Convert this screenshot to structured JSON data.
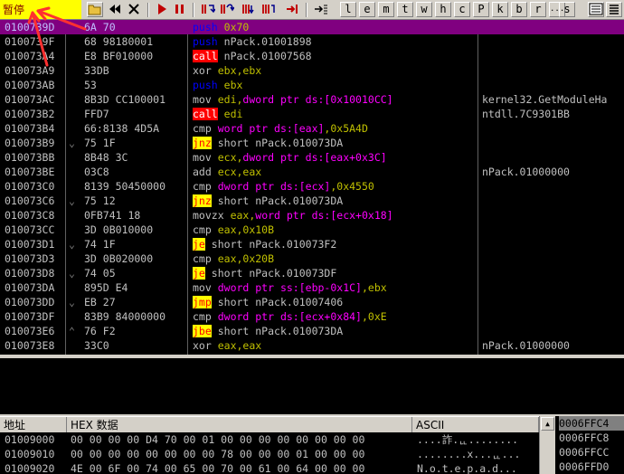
{
  "toolbar": {
    "status": "暂停",
    "letters": [
      "l",
      "e",
      "m",
      "t",
      "w",
      "h",
      "c",
      "P",
      "k",
      "b",
      "r",
      "...",
      "s"
    ]
  },
  "disasm_rows": [
    {
      "addr": "0100739D",
      "hex": "6A 70",
      "mark": "",
      "op": "push",
      "op_style": "push",
      "args": [
        {
          "t": "0x70",
          "c": "n"
        }
      ],
      "cmt": "",
      "selected": true
    },
    {
      "addr": "0100739F",
      "hex": "68 98180001",
      "mark": "",
      "op": "push",
      "op_style": "push",
      "args": [
        {
          "t": "nPack.01001898",
          "c": "w"
        }
      ],
      "cmt": ""
    },
    {
      "addr": "010073A4",
      "hex": "E8 BF010000",
      "mark": "",
      "op": "call",
      "op_style": "call",
      "args": [
        {
          "t": "nPack.01007568",
          "c": "w"
        }
      ],
      "cmt": ""
    },
    {
      "addr": "010073A9",
      "hex": "33DB",
      "mark": "",
      "op": "xor",
      "op_style": "plain",
      "args": [
        {
          "t": "ebx,ebx",
          "c": "n"
        }
      ],
      "cmt": ""
    },
    {
      "addr": "010073AB",
      "hex": "53",
      "mark": "",
      "op": "push",
      "op_style": "push",
      "args": [
        {
          "t": "ebx",
          "c": "n"
        }
      ],
      "cmt": ""
    },
    {
      "addr": "010073AC",
      "hex": "8B3D CC100001",
      "mark": "",
      "op": "mov",
      "op_style": "plain",
      "args": [
        {
          "t": "edi,",
          "c": "n"
        },
        {
          "t": "dword ptr ds:[0x10010CC]",
          "c": "k"
        }
      ],
      "cmt": "kernel32.GetModuleHa"
    },
    {
      "addr": "010073B2",
      "hex": "FFD7",
      "mark": "",
      "op": "call",
      "op_style": "call",
      "args": [
        {
          "t": "edi",
          "c": "n"
        }
      ],
      "cmt": "ntdll.7C9301BB"
    },
    {
      "addr": "010073B4",
      "hex": "66:8138 4D5A",
      "mark": "",
      "op": "cmp",
      "op_style": "plain",
      "args": [
        {
          "t": "word ptr ds:[eax]",
          "c": "k"
        },
        {
          "t": ",0x5A4D",
          "c": "n"
        }
      ],
      "cmt": ""
    },
    {
      "addr": "010073B9",
      "hex": "75 1F",
      "mark": "⌄",
      "op": "jnz",
      "op_style": "jcc",
      "args": [
        {
          "t": "short nPack.010073DA",
          "c": "w"
        }
      ],
      "cmt": ""
    },
    {
      "addr": "010073BB",
      "hex": "8B48 3C",
      "mark": "",
      "op": "mov",
      "op_style": "plain",
      "args": [
        {
          "t": "ecx,",
          "c": "n"
        },
        {
          "t": "dword ptr ds:[eax+0x3C]",
          "c": "k"
        }
      ],
      "cmt": ""
    },
    {
      "addr": "010073BE",
      "hex": "03C8",
      "mark": "",
      "op": "add",
      "op_style": "plain",
      "args": [
        {
          "t": "ecx,eax",
          "c": "n"
        }
      ],
      "cmt": "nPack.01000000"
    },
    {
      "addr": "010073C0",
      "hex": "8139 50450000",
      "mark": "",
      "op": "cmp",
      "op_style": "plain",
      "args": [
        {
          "t": "dword ptr ds:[ecx]",
          "c": "k"
        },
        {
          "t": ",0x4550",
          "c": "n"
        }
      ],
      "cmt": ""
    },
    {
      "addr": "010073C6",
      "hex": "75 12",
      "mark": "⌄",
      "op": "jnz",
      "op_style": "jcc",
      "args": [
        {
          "t": "short nPack.010073DA",
          "c": "w"
        }
      ],
      "cmt": ""
    },
    {
      "addr": "010073C8",
      "hex": "0FB741 18",
      "mark": "",
      "op": "movzx",
      "op_style": "plain",
      "args": [
        {
          "t": "eax,",
          "c": "n"
        },
        {
          "t": "word ptr ds:[ecx+0x18]",
          "c": "k"
        }
      ],
      "cmt": ""
    },
    {
      "addr": "010073CC",
      "hex": "3D 0B010000",
      "mark": "",
      "op": "cmp",
      "op_style": "plain",
      "args": [
        {
          "t": "eax,0x10B",
          "c": "n"
        }
      ],
      "cmt": ""
    },
    {
      "addr": "010073D1",
      "hex": "74 1F",
      "mark": "⌄",
      "op": "je",
      "op_style": "jcc",
      "args": [
        {
          "t": "short nPack.010073F2",
          "c": "w"
        }
      ],
      "cmt": ""
    },
    {
      "addr": "010073D3",
      "hex": "3D 0B020000",
      "mark": "",
      "op": "cmp",
      "op_style": "plain",
      "args": [
        {
          "t": "eax,0x20B",
          "c": "n"
        }
      ],
      "cmt": ""
    },
    {
      "addr": "010073D8",
      "hex": "74 05",
      "mark": "⌄",
      "op": "je",
      "op_style": "jcc",
      "args": [
        {
          "t": "short nPack.010073DF",
          "c": "w"
        }
      ],
      "cmt": ""
    },
    {
      "addr": "010073DA",
      "hex": "895D E4",
      "mark": "",
      "op": "mov",
      "op_style": "plain",
      "args": [
        {
          "t": "dword ptr ss:[ebp-0x1C]",
          "c": "k"
        },
        {
          "t": ",ebx",
          "c": "n"
        }
      ],
      "cmt": ""
    },
    {
      "addr": "010073DD",
      "hex": "EB 27",
      "mark": "⌄",
      "op": "jmp",
      "op_style": "jmp",
      "args": [
        {
          "t": "short nPack.01007406",
          "c": "w"
        }
      ],
      "cmt": ""
    },
    {
      "addr": "010073DF",
      "hex": "83B9 84000000",
      "mark": "",
      "op": "cmp",
      "op_style": "plain",
      "args": [
        {
          "t": "dword ptr ds:[ecx+0x84]",
          "c": "k"
        },
        {
          "t": ",0xE",
          "c": "n"
        }
      ],
      "cmt": ""
    },
    {
      "addr": "010073E6",
      "hex": "76 F2",
      "mark": "⌃",
      "op": "jbe",
      "op_style": "jcc",
      "args": [
        {
          "t": "short nPack.010073DA",
          "c": "w"
        }
      ],
      "cmt": ""
    },
    {
      "addr": "010073E8",
      "hex": "33C0",
      "mark": "",
      "op": "xor",
      "op_style": "plain",
      "args": [
        {
          "t": "eax,eax",
          "c": "n"
        }
      ],
      "cmt": "nPack.01000000"
    }
  ],
  "dump": {
    "headers": {
      "addr": "地址",
      "hex": "HEX 数据",
      "ascii": "ASCII"
    },
    "rows": [
      {
        "addr": "01009000",
        "hex": "00 00 00 00 D4 70 00 01 00 00 00 00 00 00 00 00",
        "ascii": "....詐.ᇿ........"
      },
      {
        "addr": "01009010",
        "hex": "00 00 00 00 00 00 00 00 78 00 00 00 01 00 00 00",
        "ascii": "........x...ᇿ..."
      },
      {
        "addr": "01009020",
        "hex": "4E 00 6F 00 74 00 65 00 70 00 61 00 64 00 00 00",
        "ascii": "N.o.t.e.p.a.d..."
      }
    ]
  },
  "stack": {
    "rows": [
      "0006FFC4",
      "0006FFC8",
      "0006FFCC",
      "0006FFD0"
    ]
  },
  "colors": {
    "accent_arrow": "#ff3030",
    "selected_row": "#800080"
  }
}
